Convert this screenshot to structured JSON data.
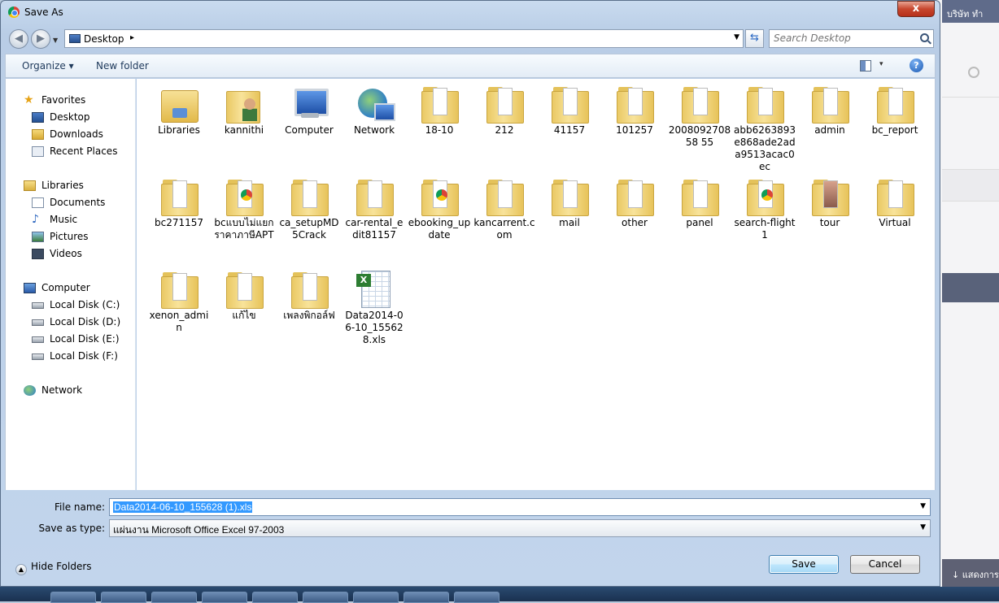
{
  "dialog": {
    "title": "Save As",
    "close_label": "x"
  },
  "nav": {
    "address": "Desktop",
    "address_arrow": "▸",
    "search_placeholder": "Search Desktop"
  },
  "toolbar": {
    "organize": "Organize ▾",
    "new_folder": "New folder",
    "view_arrow": "▾",
    "help": "?"
  },
  "navpane": [
    {
      "label": "Favorites",
      "icon": "star-icon",
      "kind": "star",
      "indent": 0
    },
    {
      "label": "Desktop",
      "icon": "desktop-icon",
      "kind": "desk",
      "indent": 1
    },
    {
      "label": "Downloads",
      "icon": "downloads-icon",
      "kind": "dl",
      "indent": 1
    },
    {
      "label": "Recent Places",
      "icon": "recent-places-icon",
      "kind": "recent",
      "indent": 1
    },
    {
      "label": "Libraries",
      "icon": "libraries-icon",
      "kind": "lib",
      "indent": 0
    },
    {
      "label": "Documents",
      "icon": "documents-icon",
      "kind": "doc",
      "indent": 1
    },
    {
      "label": "Music",
      "icon": "music-icon",
      "kind": "music",
      "indent": 1
    },
    {
      "label": "Pictures",
      "icon": "pictures-icon",
      "kind": "pic",
      "indent": 1
    },
    {
      "label": "Videos",
      "icon": "videos-icon",
      "kind": "vid",
      "indent": 1
    },
    {
      "label": "Computer",
      "icon": "computer-icon",
      "kind": "comp",
      "indent": 0
    },
    {
      "label": "Local Disk (C:)",
      "icon": "disk-icon",
      "kind": "disk",
      "indent": 1
    },
    {
      "label": "Local Disk (D:)",
      "icon": "disk-icon",
      "kind": "disk",
      "indent": 1
    },
    {
      "label": "Local Disk (E:)",
      "icon": "disk-icon",
      "kind": "disk",
      "indent": 1
    },
    {
      "label": "Local Disk (F:)",
      "icon": "disk-icon",
      "kind": "disk",
      "indent": 1
    },
    {
      "label": "Network",
      "icon": "network-icon",
      "kind": "net",
      "indent": 0
    }
  ],
  "files": [
    {
      "name": "Libraries",
      "kind": "lib"
    },
    {
      "name": "kannithi",
      "kind": "user"
    },
    {
      "name": "Computer",
      "kind": "comp"
    },
    {
      "name": "Network",
      "kind": "net"
    },
    {
      "name": "18-10",
      "kind": "folder"
    },
    {
      "name": "212",
      "kind": "folder"
    },
    {
      "name": "41157",
      "kind": "folder"
    },
    {
      "name": "101257",
      "kind": "folder"
    },
    {
      "name": "200809270858 55",
      "kind": "folder"
    },
    {
      "name": "abb6263893e868ade2ada9513acac0ec",
      "kind": "folder"
    },
    {
      "name": "admin",
      "kind": "folder"
    },
    {
      "name": "bc_report",
      "kind": "folder"
    },
    {
      "name": "bc271157",
      "kind": "folder"
    },
    {
      "name": "bcแบบไม่แยกราคาภาษีAPT",
      "kind": "folder-red"
    },
    {
      "name": "ca_setupMD5Crack",
      "kind": "folder"
    },
    {
      "name": "car-rental_edit81157",
      "kind": "folder"
    },
    {
      "name": "ebooking_update",
      "kind": "folder-red"
    },
    {
      "name": "kancarrent.com",
      "kind": "folder"
    },
    {
      "name": "mail",
      "kind": "folder"
    },
    {
      "name": "other",
      "kind": "folder"
    },
    {
      "name": "panel",
      "kind": "folder"
    },
    {
      "name": "search-flight1",
      "kind": "folder-red"
    },
    {
      "name": "tour",
      "kind": "folder-img"
    },
    {
      "name": "Virtual",
      "kind": "folder"
    },
    {
      "name": "xenon_admin",
      "kind": "folder"
    },
    {
      "name": "แก้ไข",
      "kind": "folder"
    },
    {
      "name": "เพลงพิกอล์ฟ",
      "kind": "folder"
    },
    {
      "name": "Data2014-06-10_155628.xls",
      "kind": "xls"
    }
  ],
  "form": {
    "filename_label": "File name:",
    "filename_value": "Data2014-06-10_155628 (1).xls",
    "savetype_label": "Save as type:",
    "savetype_value": "แผ่นงาน Microsoft Office Excel 97-2003"
  },
  "footer": {
    "hide_folders": "Hide Folders",
    "save": "Save",
    "cancel": "Cancel"
  },
  "background": {
    "top_text": "บริษัท ทำ",
    "bottom_text": "↓ แสดงการ"
  }
}
